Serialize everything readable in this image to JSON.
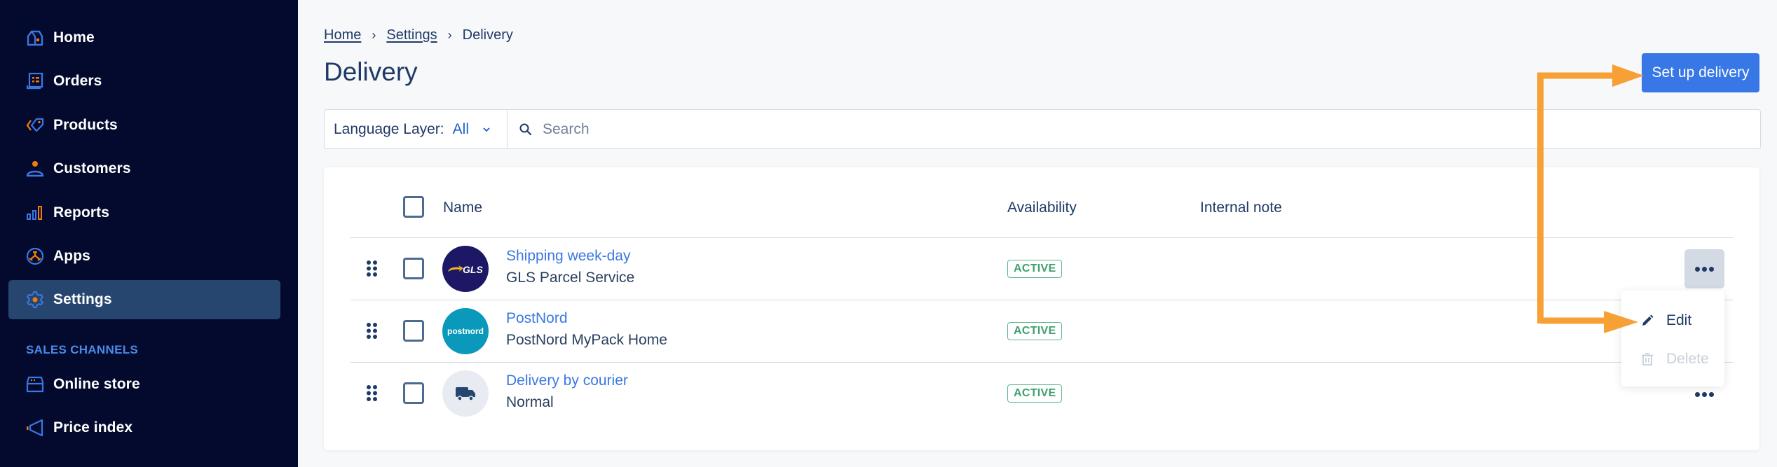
{
  "sidebar": {
    "items": [
      {
        "label": "Home",
        "icon": "home-icon"
      },
      {
        "label": "Orders",
        "icon": "orders-icon"
      },
      {
        "label": "Products",
        "icon": "tag-icon"
      },
      {
        "label": "Customers",
        "icon": "person-icon"
      },
      {
        "label": "Reports",
        "icon": "bar-chart-icon"
      },
      {
        "label": "Apps",
        "icon": "apps-icon"
      },
      {
        "label": "Settings",
        "icon": "gear-icon",
        "active": true
      }
    ],
    "section_label": "SALES CHANNELS",
    "channels": [
      {
        "label": "Online store",
        "icon": "store-icon"
      },
      {
        "label": "Price index",
        "icon": "megaphone-icon"
      }
    ]
  },
  "breadcrumb": {
    "items": [
      "Home",
      "Settings",
      "Delivery"
    ],
    "separator": "›"
  },
  "page": {
    "title": "Delivery",
    "primary_action": "Set up delivery"
  },
  "filters": {
    "language_label": "Language Layer:",
    "language_value": "All",
    "search_placeholder": "Search",
    "search_value": ""
  },
  "table": {
    "columns": [
      "Name",
      "Availability",
      "Internal note"
    ],
    "rows": [
      {
        "title": "Shipping week-day",
        "subtitle": "GLS Parcel Service",
        "logo": "gls-logo",
        "availability": "ACTIVE",
        "internal_note": ""
      },
      {
        "title": "PostNord",
        "subtitle": "PostNord MyPack Home",
        "logo": "postnord-logo",
        "availability": "ACTIVE",
        "internal_note": ""
      },
      {
        "title": "Delivery by courier",
        "subtitle": "Normal",
        "logo": "truck-icon",
        "availability": "ACTIVE",
        "internal_note": ""
      }
    ]
  },
  "row_menu": {
    "items": [
      {
        "label": "Edit",
        "icon": "pencil-icon",
        "enabled": true
      },
      {
        "label": "Delete",
        "icon": "trash-icon",
        "enabled": false
      }
    ]
  },
  "logos": {
    "gls_text": "GLS",
    "postnord_text": "postnord"
  },
  "colors": {
    "sidebar_bg": "#030a2e",
    "sidebar_active": "#26466f",
    "accent_blue": "#3878e6",
    "icon_orange": "#f07d12",
    "annotation_orange": "#f7a035",
    "active_green": "#3fa06f",
    "text_navy": "#1f3a66"
  }
}
